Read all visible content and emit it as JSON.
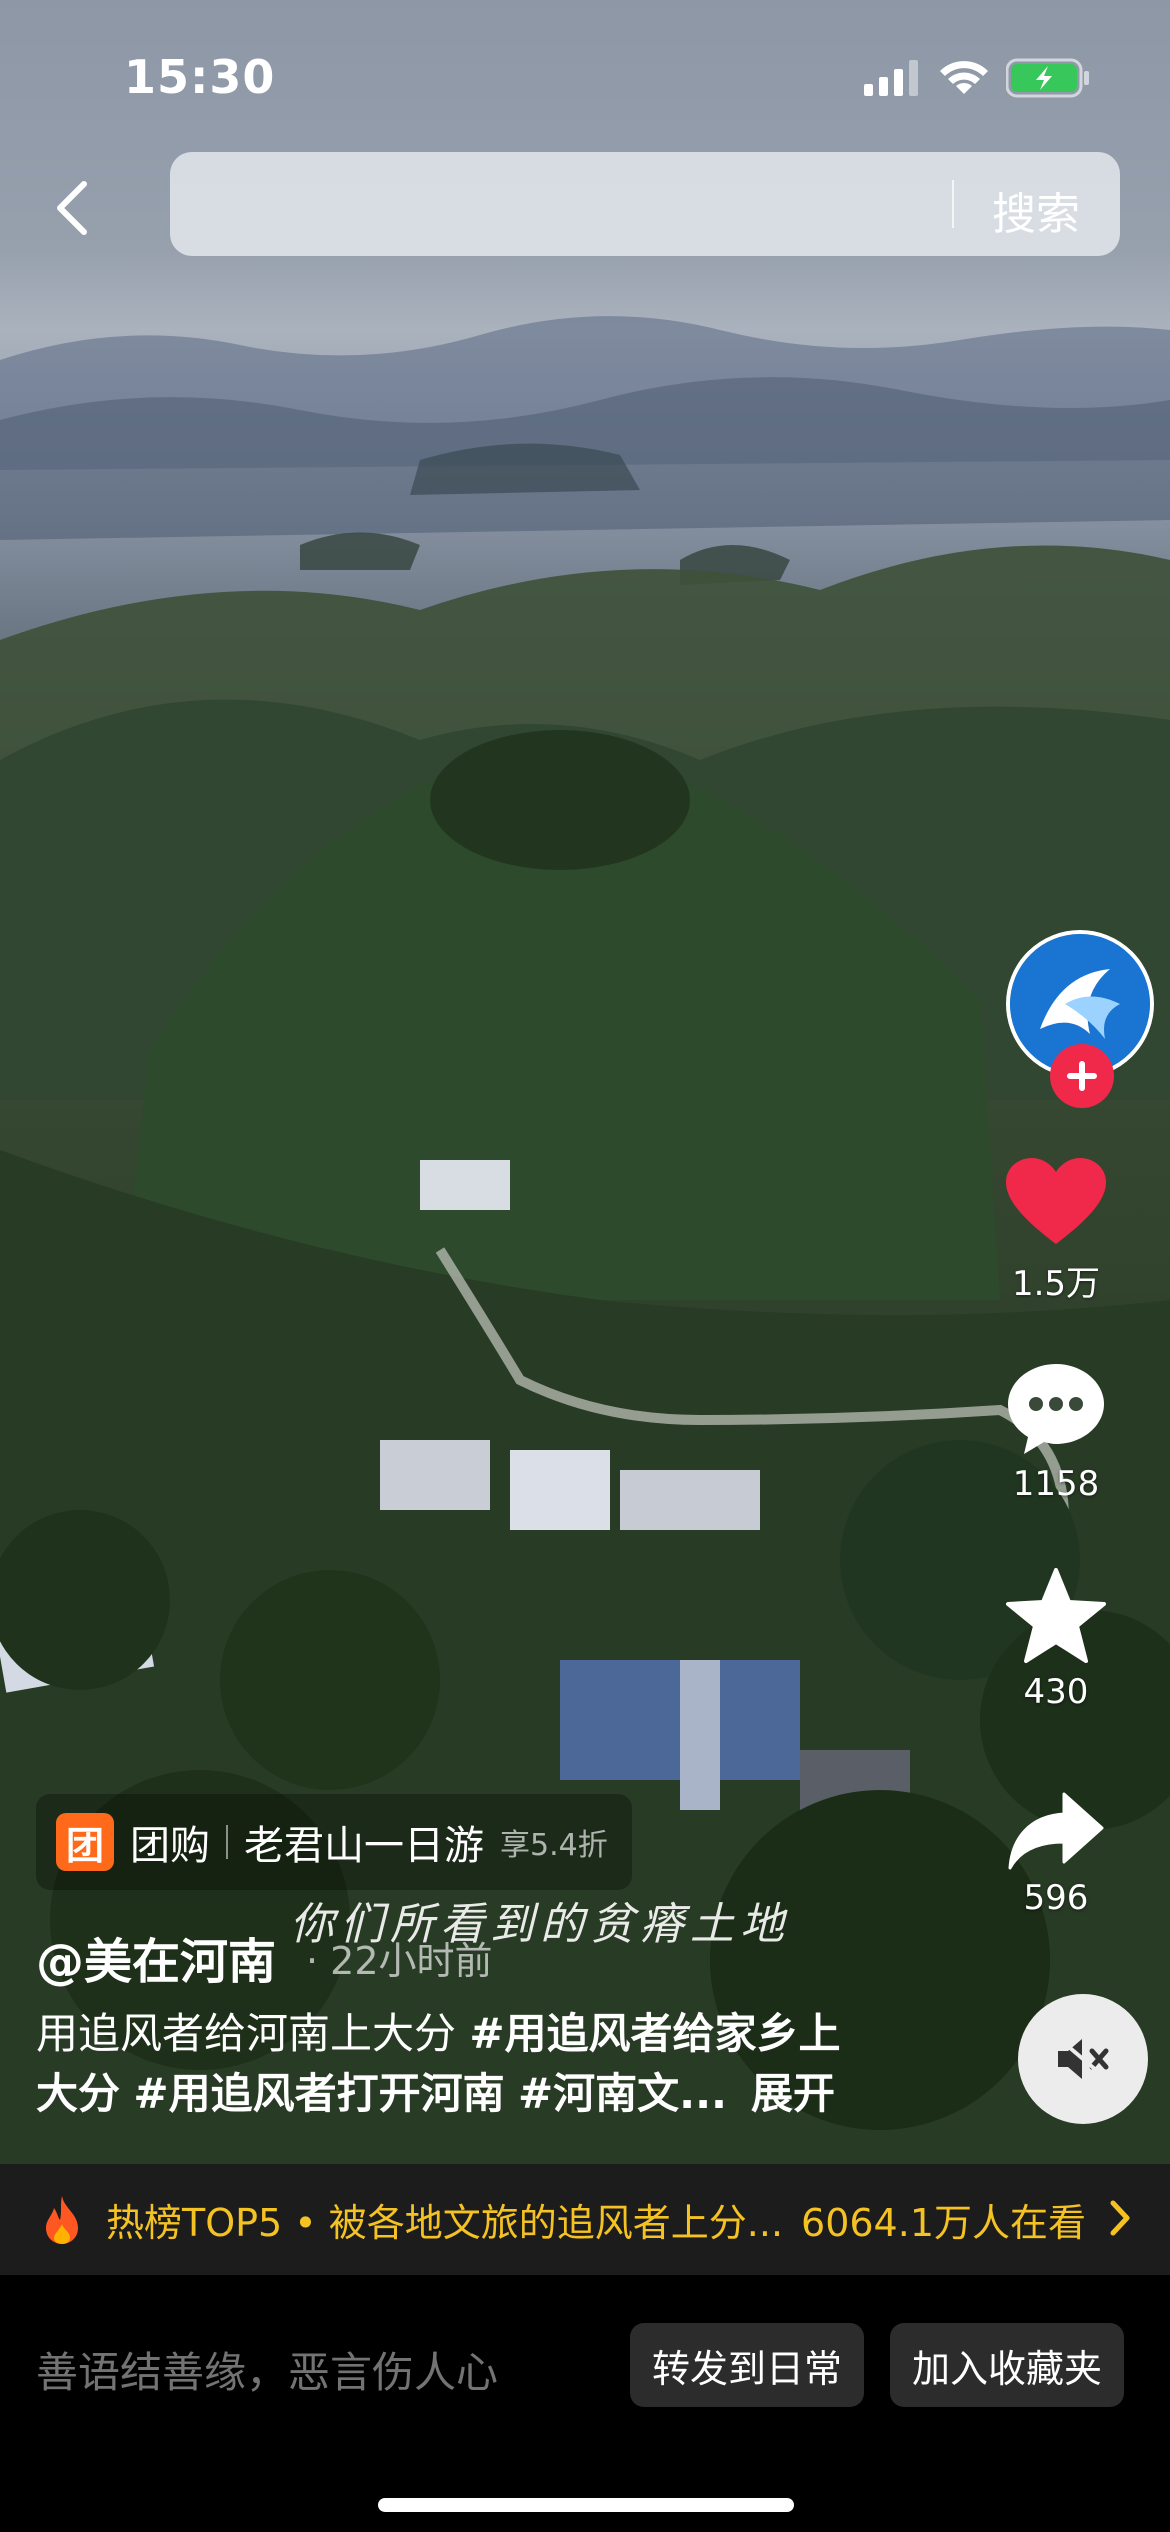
{
  "status_bar": {
    "time": "15:30",
    "signal_icon": "signal-icon",
    "wifi_icon": "wifi-icon",
    "battery_icon": "battery-charging-icon",
    "battery_color": "#38c75a"
  },
  "header": {
    "back_icon": "chevron-left-icon",
    "search_value": "",
    "search_button": "搜索"
  },
  "video": {
    "caption": "你们所看到的贫瘠土地",
    "mute_icon": "speaker-muted-icon"
  },
  "actions": {
    "avatar_follow_icon": "plus-icon",
    "like": {
      "icon": "heart-icon",
      "count": "1.5万",
      "color": "#f0284a"
    },
    "comment": {
      "icon": "comment-icon",
      "count": "1158"
    },
    "favorite": {
      "icon": "star-icon",
      "count": "430"
    },
    "share": {
      "icon": "share-icon",
      "count": "596"
    }
  },
  "group_buy": {
    "badge": "团",
    "label": "团购",
    "title": "老君山一日游",
    "discount": "享5.4折",
    "accent": "#ff6a1a"
  },
  "post": {
    "author": "@美在河南",
    "time": "· 22小时前",
    "desc_text": "用追风者给河南上大分 ",
    "tags": [
      "#用追风者给家乡上",
      "大分",
      "#用追风者打开河南",
      "#河南文..."
    ],
    "more": "展开"
  },
  "hot_bar": {
    "icon": "flame-icon",
    "text": "热榜TOP5 • 被各地文旅的追风者上分...",
    "views": "6064.1万人在看",
    "chevron_icon": "chevron-right-icon",
    "color": "#f5c224"
  },
  "bottom_bar": {
    "comment_placeholder": "善语结善缘，恶言伤人心",
    "share_daily": "转发到日常",
    "add_favorite": "加入收藏夹"
  }
}
